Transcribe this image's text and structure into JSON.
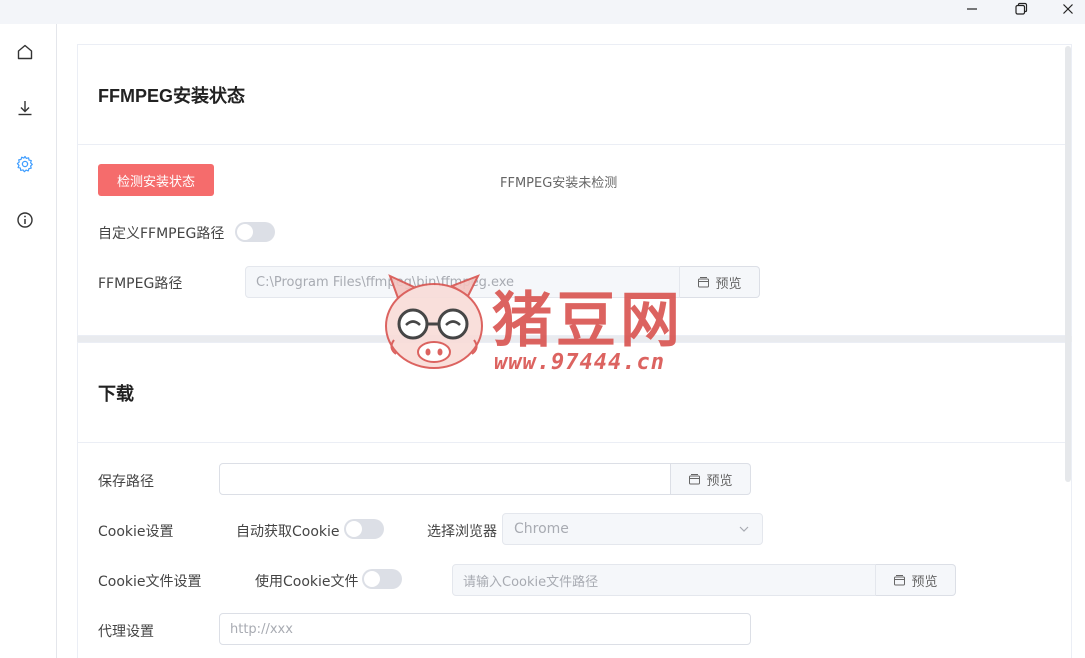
{
  "window": {
    "controls": [
      "minimize-icon",
      "restore-icon",
      "close-icon"
    ]
  },
  "sidebar": {
    "items": [
      {
        "icon": "home-icon"
      },
      {
        "icon": "download-icon"
      },
      {
        "icon": "gear-icon",
        "active": true
      },
      {
        "icon": "info-icon"
      }
    ],
    "accent": "#409eff"
  },
  "ffmpeg_section": {
    "title": "FFMPEG安装状态",
    "check_button": "检测安装状态",
    "status": "FFMPEG安装未检测",
    "custom_path_label": "自定义FFMPEG路径",
    "custom_path_enabled": false,
    "path_label": "FFMPEG路径",
    "path_value": "C:\\Program Files\\ffmpeg\\bin\\ffmpeg.exe",
    "browse_label": "预览"
  },
  "download_section": {
    "title": "下载",
    "save_path_label": "保存路径",
    "save_path_value": "",
    "save_browse_label": "预览",
    "cookie_label": "Cookie设置",
    "auto_cookie_label": "自动获取Cookie",
    "auto_cookie_enabled": false,
    "browser_label": "选择浏览器",
    "browser_value": "Chrome",
    "cookie_file_label": "Cookie文件设置",
    "use_cookie_file_label": "使用Cookie文件",
    "use_cookie_file_enabled": false,
    "cookie_file_placeholder": "请输入Cookie文件路径",
    "cookie_browse_label": "预览",
    "proxy_label": "代理设置",
    "proxy_placeholder": "http://xxx"
  },
  "watermark": {
    "name": "猪豆网",
    "url": "www.97444.cn"
  },
  "colors": {
    "danger": "#f56c6c",
    "watermark": "#d9534f"
  }
}
